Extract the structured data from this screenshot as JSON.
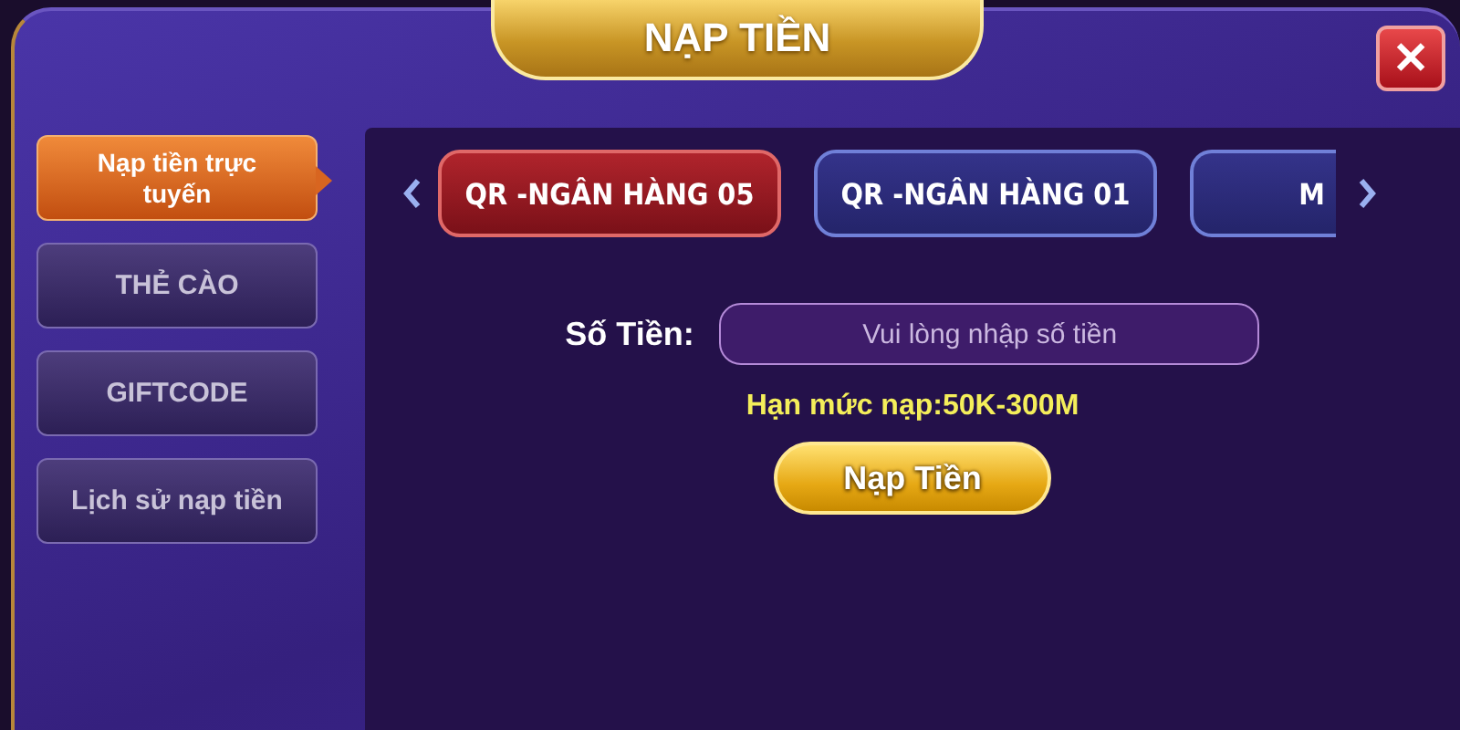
{
  "title": "NẠP TIỀN",
  "close": "✕",
  "sidebar": {
    "items": [
      {
        "label": "Nạp tiền trực tuyến",
        "selected": true
      },
      {
        "label": "THẺ CÀO",
        "selected": false
      },
      {
        "label": "GIFTCODE",
        "selected": false
      },
      {
        "label": "Lịch sử nạp tiền",
        "selected": false
      }
    ]
  },
  "tabs": [
    {
      "label": "QR -NGÂN HÀNG 05",
      "selected": true
    },
    {
      "label": "QR -NGÂN HÀNG 01",
      "selected": false
    },
    {
      "label": "M",
      "selected": false
    }
  ],
  "amount": {
    "label": "Số Tiền:",
    "placeholder": "Vui lòng nhập số tiền"
  },
  "limit": "Hạn mức nạp:50K-300M",
  "submit": "Nạp Tiền"
}
